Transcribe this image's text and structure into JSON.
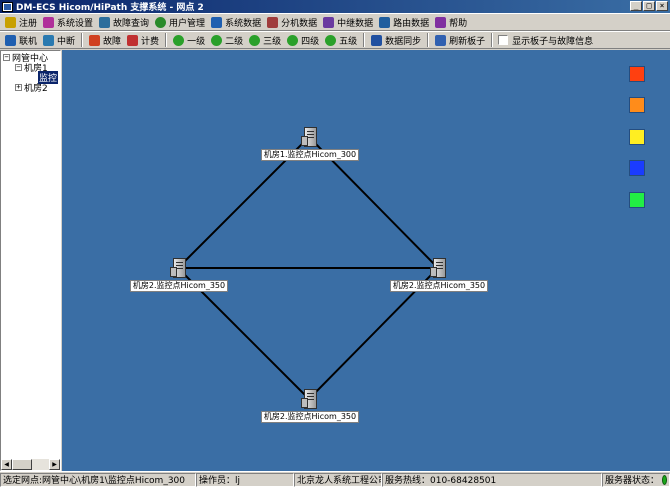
{
  "window": {
    "title": "DM-ECS Hicom/HiPath 支撑系统 - 网点 2",
    "buttons": [
      "_",
      "□",
      "×"
    ]
  },
  "menu_toolbar": [
    {
      "label": "注册",
      "icon": "key-icon",
      "color": "#c8a000"
    },
    {
      "label": "系统设置",
      "icon": "settings-icon",
      "color": "#b0309a"
    },
    {
      "label": "故障查询",
      "icon": "fault-query-icon",
      "color": "#2c6e9c"
    },
    {
      "label": "用户管理",
      "icon": "users-icon",
      "color": "#2a8a2a"
    },
    {
      "label": "系统数据",
      "icon": "system-data-icon",
      "color": "#1f5fb0"
    },
    {
      "label": "分机数据",
      "icon": "extension-data-icon",
      "color": "#a03c3c"
    },
    {
      "label": "中继数据",
      "icon": "trunk-data-icon",
      "color": "#6a3aa0"
    },
    {
      "label": "路由数据",
      "icon": "route-data-icon",
      "color": "#205e9e"
    },
    {
      "label": "帮助",
      "icon": "help-icon",
      "color": "#8030a0"
    }
  ],
  "action_toolbar": {
    "buttons": [
      {
        "label": "联机",
        "icon": "connect-icon",
        "color": "#1f5fb0"
      },
      {
        "label": "中断",
        "icon": "disconnect-icon",
        "color": "#2a7ab0"
      },
      {
        "label": "故障",
        "icon": "fault-icon",
        "color": "#d04020"
      },
      {
        "label": "计费",
        "icon": "billing-icon",
        "color": "#c03030"
      },
      {
        "label": "一级",
        "icon": "level-1-icon",
        "color": "#2aa02a"
      },
      {
        "label": "二级",
        "icon": "level-2-icon",
        "color": "#2aa02a"
      },
      {
        "label": "三级",
        "icon": "level-3-icon",
        "color": "#2aa02a"
      },
      {
        "label": "四级",
        "icon": "level-4-icon",
        "color": "#2aa02a"
      },
      {
        "label": "五级",
        "icon": "level-5-icon",
        "color": "#2aa02a"
      },
      {
        "label": "数据同步",
        "icon": "data-sync-icon",
        "color": "#2050a0"
      },
      {
        "label": "刷新板子",
        "icon": "refresh-board-icon",
        "color": "#3060b0"
      }
    ],
    "checkbox_label": "显示板子与故障信息",
    "checkbox_checked": false
  },
  "tree": {
    "root": "网管中心",
    "items": [
      "机房1",
      "监控",
      "机房2"
    ],
    "selected": "监控"
  },
  "canvas": {
    "background": "#3a6ea5",
    "legend_colors": [
      "#ff4010",
      "#ff8c1a",
      "#ffee22",
      "#1a3cff",
      "#22ee44"
    ],
    "nodes": [
      {
        "label": "机房1.监控点Hicom_300"
      },
      {
        "label": "机房2.监控点Hicom_350"
      },
      {
        "label": "机房2.监控点Hicom_350"
      },
      {
        "label": "机房2.监控点Hicom_350"
      }
    ]
  },
  "status_bar": {
    "selected_node": "选定网点:网管中心\\机房1\\监控点Hicom_300",
    "operator": "操作员：lj",
    "company": "北京龙人系统工程公司",
    "hotline": "服务热线：010-68428501",
    "server_status": "服务器状态："
  }
}
